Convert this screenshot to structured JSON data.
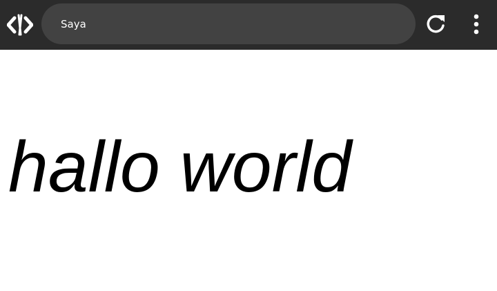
{
  "toolbar": {
    "logo_icon": "code-logo-icon",
    "address": "Saya",
    "reload_icon": "reload-icon",
    "menu_icon": "more-vertical-icon"
  },
  "page": {
    "heading": "hallo world"
  },
  "colors": {
    "toolbar_bg": "#2b2b2b",
    "address_bg": "#424242",
    "icon": "#ffffff",
    "page_bg": "#ffffff",
    "text": "#000000"
  }
}
